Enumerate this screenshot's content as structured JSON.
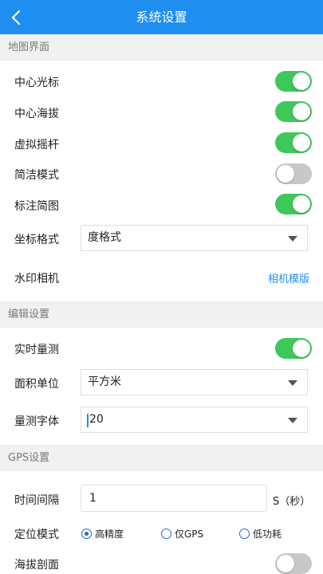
{
  "header": {
    "title": "系统设置"
  },
  "sections": {
    "map": "地图界面",
    "edit": "编辑设置",
    "gps": "GPS设置"
  },
  "map_settings": {
    "center_cursor": {
      "label": "中心光标",
      "on": true
    },
    "center_altitude": {
      "label": "中心海拔",
      "on": true
    },
    "virtual_joystick": {
      "label": "虚拟摇杆",
      "on": true
    },
    "simple_mode": {
      "label": "简洁模式",
      "on": false
    },
    "annotate_sketch": {
      "label": "标注简图",
      "on": true
    },
    "coordinate_format": {
      "label": "坐标格式",
      "value": "度格式"
    },
    "watermark_camera": {
      "label": "水印相机",
      "link": "相机模版"
    }
  },
  "edit_settings": {
    "realtime_measure": {
      "label": "实时量测",
      "on": true
    },
    "area_unit": {
      "label": "面积单位",
      "value": "平方米"
    },
    "measure_font": {
      "label": "量测字体",
      "value": "20"
    }
  },
  "gps_settings": {
    "time_interval": {
      "label": "时间间隔",
      "value": "1",
      "unit": "S（秒）"
    },
    "location_mode": {
      "label": "定位模式",
      "options": [
        "高精度",
        "仅GPS",
        "低功耗"
      ],
      "selected": "高精度"
    },
    "altitude_profile": {
      "label": "海拔剖面",
      "on": false
    }
  },
  "colors": {
    "header": "#1f8ef1",
    "toggle_on": "#3ec85a",
    "toggle_off": "#c8c8c8",
    "link": "#1f8ef1"
  }
}
